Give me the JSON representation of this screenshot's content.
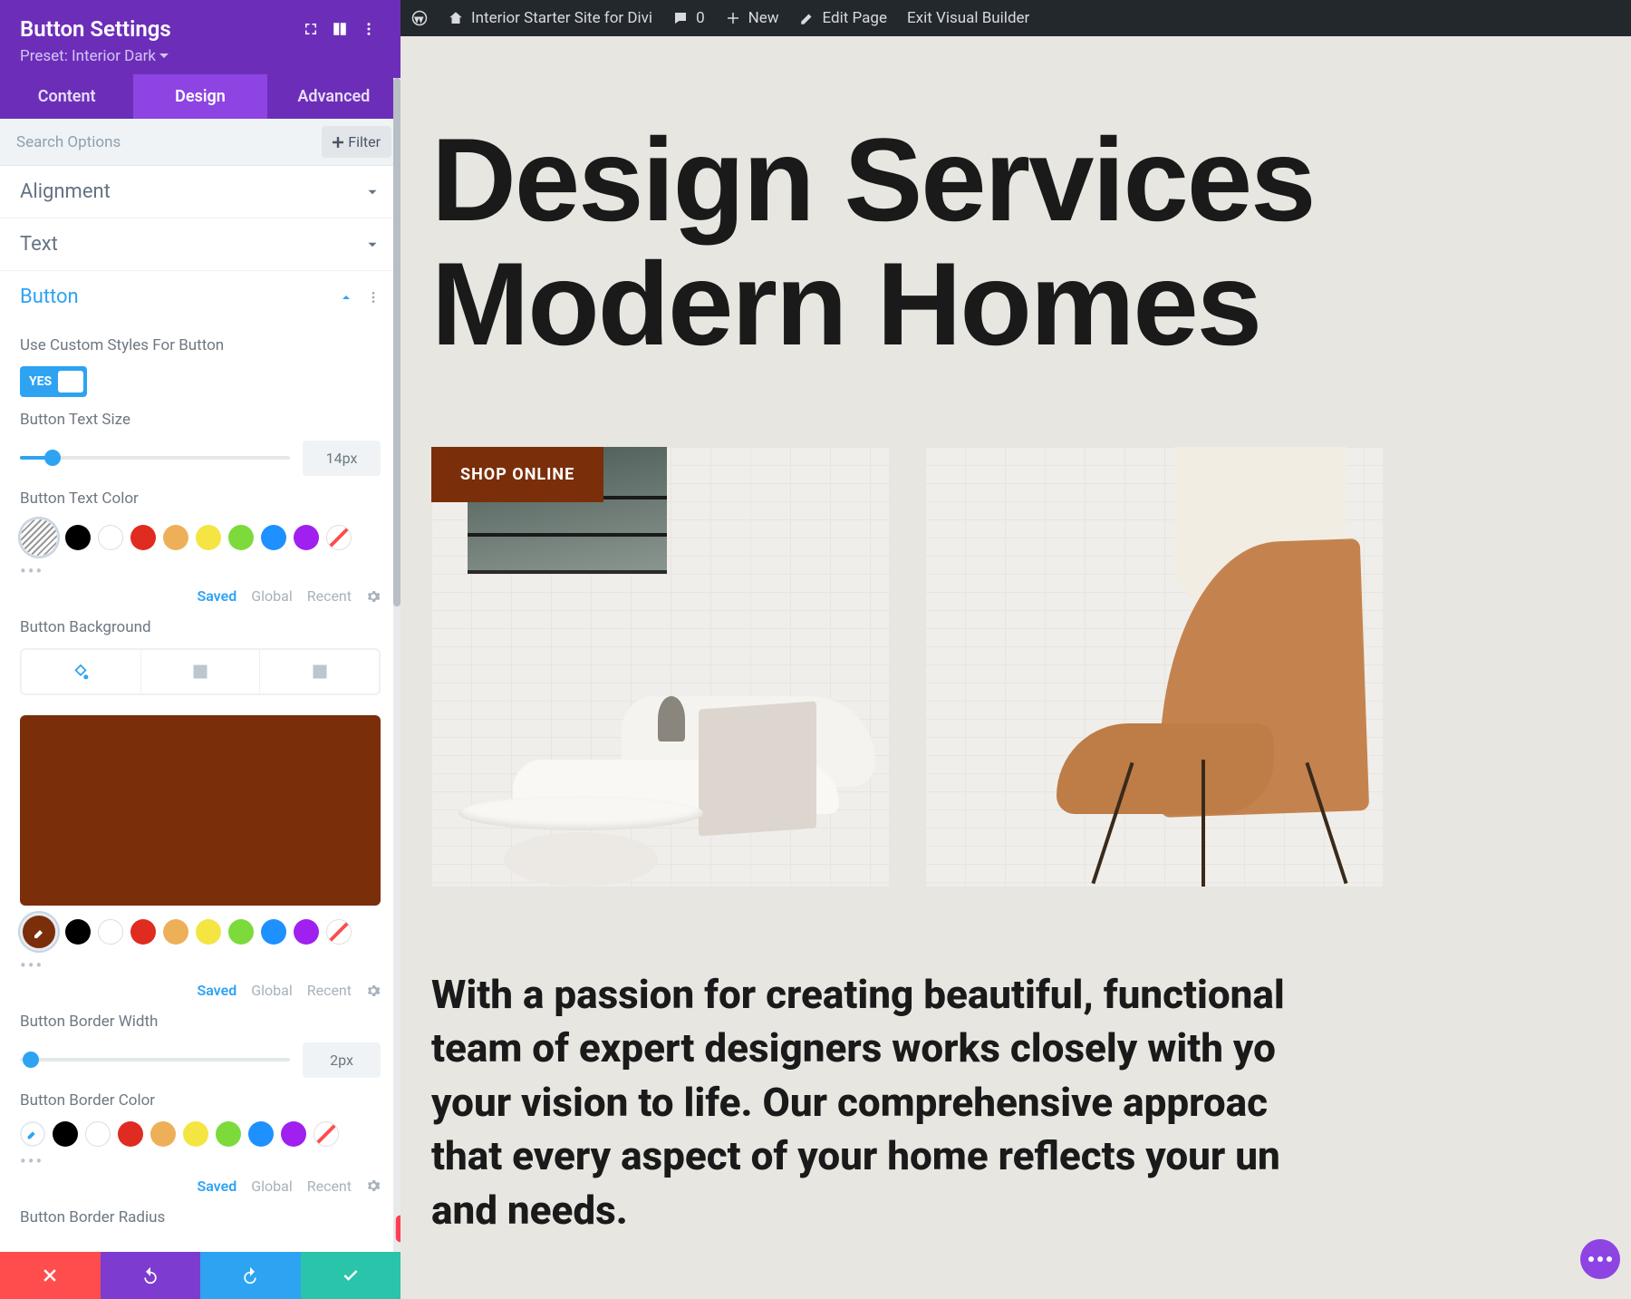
{
  "panel": {
    "title": "Button Settings",
    "preset": "Preset: Interior Dark",
    "tabs": {
      "content": "Content",
      "design": "Design",
      "advanced": "Advanced"
    },
    "search_placeholder": "Search Options",
    "filter_label": "Filter"
  },
  "sections": {
    "alignment": "Alignment",
    "text": "Text",
    "button": "Button"
  },
  "fields": {
    "custom_styles_label": "Use Custom Styles For Button",
    "custom_styles_value": "YES",
    "text_size_label": "Button Text Size",
    "text_size_value": "14px",
    "text_color_label": "Button Text Color",
    "bg_label": "Button Background",
    "bg_color": "#7a2e0a",
    "border_width_label": "Button Border Width",
    "border_width_value": "2px",
    "border_color_label": "Button Border Color",
    "border_radius_label": "Button Border Radius",
    "links": {
      "saved": "Saved",
      "global": "Global",
      "recent": "Recent"
    }
  },
  "palette": [
    "#000000",
    "#ffffff",
    "#e02b20",
    "#edb059",
    "#f4e542",
    "#7cdb3a",
    "#1e90ff",
    "#a020f0"
  ],
  "wp": {
    "site": "Interior Starter Site for Divi",
    "comments": "0",
    "new": "New",
    "edit": "Edit Page",
    "exit": "Exit Visual Builder"
  },
  "page": {
    "hero_line1": "Design Services",
    "hero_line2": "Modern Homes",
    "shop_btn": "SHOP ONLINE",
    "body_l1": "With a passion for creating beautiful, functional",
    "body_l2": "team of expert designers works closely with yo",
    "body_l3": "your vision to life. Our comprehensive approac",
    "body_l4": "that every aspect of your home reflects your un",
    "body_l5": "and needs."
  }
}
